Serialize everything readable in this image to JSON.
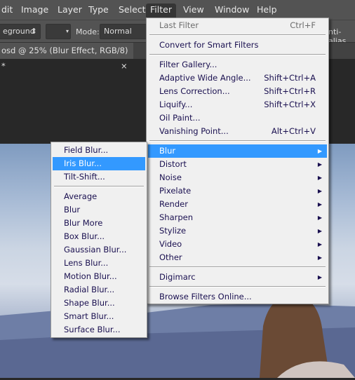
{
  "menubar": [
    "dit",
    "Image",
    "Layer",
    "Type",
    "Select",
    "Filter",
    "View",
    "Window",
    "Help"
  ],
  "options": {
    "fill_source": "eground",
    "mode_label": "Mode:",
    "mode_value": "Normal",
    "anti_alias": "nti-alias"
  },
  "document_tab": {
    "title": "osd @ 25% (Blur Effect, RGB/8) *",
    "close": "×"
  },
  "filter_menu": [
    {
      "label": "Last Filter",
      "shortcut": "Ctrl+F",
      "disabled": true
    },
    {
      "sep": true
    },
    {
      "label": "Convert for Smart Filters"
    },
    {
      "sep": true
    },
    {
      "label": "Filter Gallery..."
    },
    {
      "label": "Adaptive Wide Angle...",
      "shortcut": "Shift+Ctrl+A"
    },
    {
      "label": "Lens Correction...",
      "shortcut": "Shift+Ctrl+R"
    },
    {
      "label": "Liquify...",
      "shortcut": "Shift+Ctrl+X"
    },
    {
      "label": "Oil Paint..."
    },
    {
      "label": "Vanishing Point...",
      "shortcut": "Alt+Ctrl+V"
    },
    {
      "sep": true
    },
    {
      "label": "Blur",
      "submenu": true,
      "highlighted": true
    },
    {
      "label": "Distort",
      "submenu": true
    },
    {
      "label": "Noise",
      "submenu": true
    },
    {
      "label": "Pixelate",
      "submenu": true
    },
    {
      "label": "Render",
      "submenu": true
    },
    {
      "label": "Sharpen",
      "submenu": true
    },
    {
      "label": "Stylize",
      "submenu": true
    },
    {
      "label": "Video",
      "submenu": true
    },
    {
      "label": "Other",
      "submenu": true
    },
    {
      "sep": true
    },
    {
      "label": "Digimarc",
      "submenu": true
    },
    {
      "sep": true
    },
    {
      "label": "Browse Filters Online..."
    }
  ],
  "blur_submenu": [
    {
      "label": "Field Blur..."
    },
    {
      "label": "Iris Blur...",
      "highlighted": true
    },
    {
      "label": "Tilt-Shift..."
    },
    {
      "sep": true
    },
    {
      "label": "Average"
    },
    {
      "label": "Blur"
    },
    {
      "label": "Blur More"
    },
    {
      "label": "Box Blur..."
    },
    {
      "label": "Gaussian Blur..."
    },
    {
      "label": "Lens Blur..."
    },
    {
      "label": "Motion Blur..."
    },
    {
      "label": "Radial Blur..."
    },
    {
      "label": "Shape Blur..."
    },
    {
      "label": "Smart Blur..."
    },
    {
      "label": "Surface Blur..."
    }
  ],
  "colors": {
    "highlight": "#3399ff",
    "menu_bg": "#f0f0f0",
    "ui_dark": "#535353"
  }
}
